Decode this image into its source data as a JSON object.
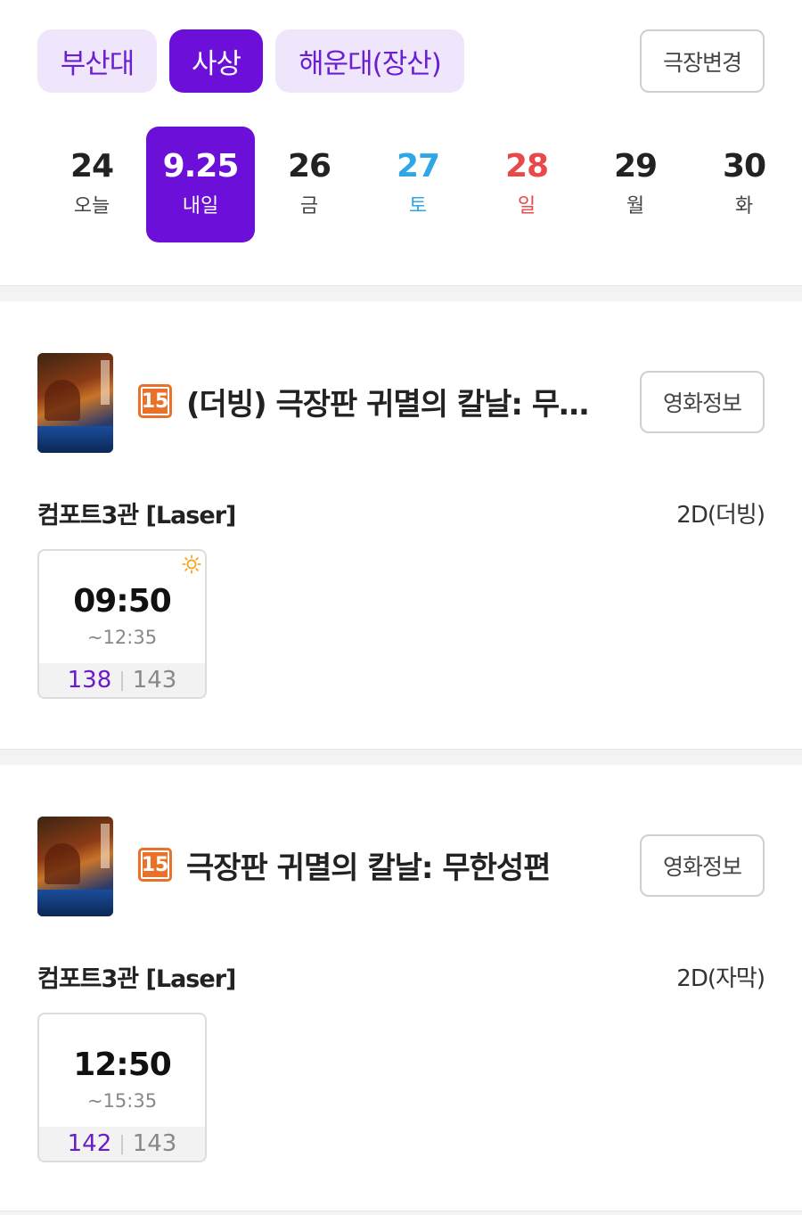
{
  "theaters": {
    "items": [
      {
        "label": "부산대",
        "active": false
      },
      {
        "label": "사상",
        "active": true
      },
      {
        "label": "해운대(장산)",
        "active": false
      }
    ],
    "change_label": "극장변경"
  },
  "dates": [
    {
      "num": "24",
      "day": "오늘",
      "kind": "normal"
    },
    {
      "num": "9.25",
      "day": "내일",
      "kind": "active"
    },
    {
      "num": "26",
      "day": "금",
      "kind": "normal"
    },
    {
      "num": "27",
      "day": "토",
      "kind": "sat"
    },
    {
      "num": "28",
      "day": "일",
      "kind": "sun"
    },
    {
      "num": "29",
      "day": "월",
      "kind": "normal"
    },
    {
      "num": "30",
      "day": "화",
      "kind": "normal"
    }
  ],
  "movies": [
    {
      "rating": "15",
      "title": "(더빙) 극장판 귀멸의 칼날: 무한성편",
      "info_label": "영화정보",
      "hall": "컴포트3관 [Laser]",
      "format": "2D(더빙)",
      "showtimes": [
        {
          "start": "09:50",
          "end": "~12:35",
          "remaining": "138",
          "total": "143",
          "morning": true
        }
      ]
    },
    {
      "rating": "15",
      "title": "극장판 귀멸의 칼날: 무한성편",
      "info_label": "영화정보",
      "hall": "컴포트3관 [Laser]",
      "format": "2D(자막)",
      "showtimes": [
        {
          "start": "12:50",
          "end": "~15:35",
          "remaining": "142",
          "total": "143",
          "morning": false
        }
      ]
    }
  ],
  "colors": {
    "accent": "#6b0fd9",
    "chip_bg": "#efe6fb",
    "saturday": "#2fa6e6",
    "sunday": "#e8494b",
    "rating_15": "#e8722a"
  },
  "icons": {
    "morning": "sun-icon"
  }
}
